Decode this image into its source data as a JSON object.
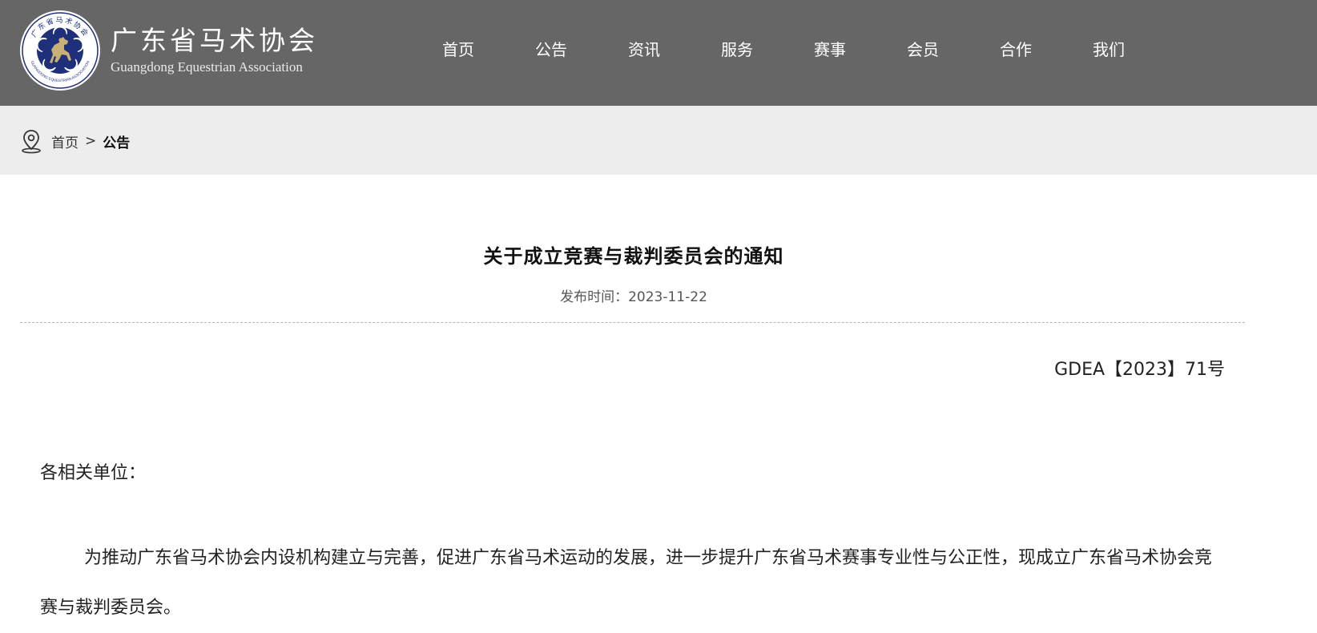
{
  "header": {
    "logo": {
      "name_cn": "广东省马术协会",
      "name_en": "Guangdong Equestrian Association",
      "emblem_ring_text_cn": "广东省马术协会",
      "emblem_ring_text_en": "GUANGDONG EQUESTRIAN ASSOCIATION"
    },
    "nav": [
      {
        "label": "首页"
      },
      {
        "label": "公告"
      },
      {
        "label": "资讯"
      },
      {
        "label": "服务"
      },
      {
        "label": "赛事"
      },
      {
        "label": "会员"
      },
      {
        "label": "合作"
      },
      {
        "label": "我们"
      }
    ],
    "colors": {
      "background": "#666666",
      "text": "#ffffff"
    }
  },
  "breadcrumb": {
    "icon": "location-pin-icon",
    "home": "首页",
    "separator": ">",
    "current": "公告",
    "background": "#ededed"
  },
  "article": {
    "title": "关于成立竞赛与裁判委员会的通知",
    "publish_time_label": "发布时间：",
    "publish_time": "2023-11-22",
    "doc_number": "GDEA【2023】71号",
    "salutation": "各相关单位：",
    "paragraph_1": "为推动广东省马术协会内设机构建立与完善，促进广东省马术运动的发展，进一步提升广东省马术赛事专业性与公正性，现成立广东省马术协会竞赛与裁判委员会。"
  }
}
